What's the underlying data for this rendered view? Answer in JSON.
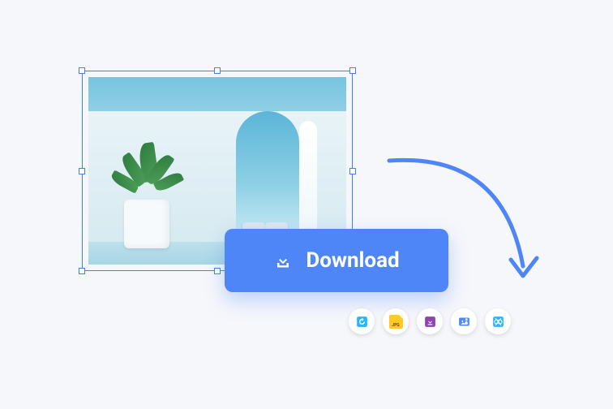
{
  "download_button": {
    "label": "Download",
    "icon": "download-icon"
  },
  "toolbar": {
    "items": [
      {
        "name": "rotate",
        "icon": "rotate-icon",
        "color": "#29b6f6"
      },
      {
        "name": "jpg-convert",
        "icon": "jpg-icon",
        "label": "JPG",
        "color": "#ffca28"
      },
      {
        "name": "download-file",
        "icon": "file-download-icon",
        "color": "#8e44ad"
      },
      {
        "name": "resize",
        "icon": "resize-icon",
        "color": "#4f86f7"
      },
      {
        "name": "crop",
        "icon": "crop-icon",
        "color": "#29b6f6"
      }
    ]
  },
  "colors": {
    "accent": "#4f86f7",
    "arrow": "#4f86f7",
    "selection": "#3b82f6"
  }
}
